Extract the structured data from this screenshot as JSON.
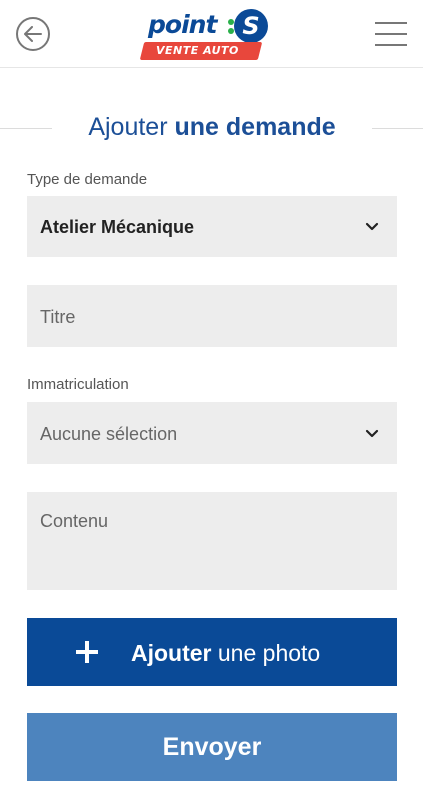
{
  "header": {
    "logo": {
      "word": "point",
      "letter": "S",
      "band": "VENTE AUTO"
    }
  },
  "page": {
    "title_part1": "Ajouter",
    "title_part2": "une demande"
  },
  "form": {
    "type_label": "Type de demande",
    "type_value": "Atelier Mécanique",
    "title_placeholder": "Titre",
    "plate_label": "Immatriculation",
    "plate_value": "Aucune sélection",
    "content_placeholder": "Contenu"
  },
  "buttons": {
    "add_photo_bold": "Ajouter",
    "add_photo_light": "une photo",
    "send": "Envoyer"
  },
  "colors": {
    "brand_blue": "#0a4a97",
    "send_blue": "#4d84be",
    "logo_red": "#e8473c",
    "field_bg": "#ededed"
  },
  "icons": {
    "back": "back-arrow-icon",
    "menu": "hamburger-menu-icon",
    "chevron": "chevron-down-icon",
    "plus": "plus-icon"
  }
}
